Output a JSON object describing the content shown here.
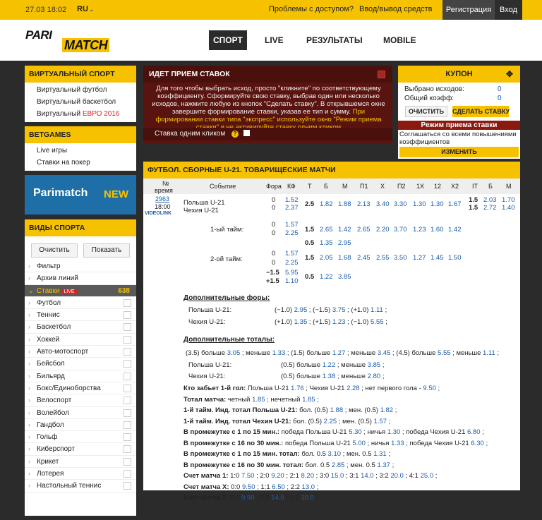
{
  "topbar": {
    "date": "27.03 18:02",
    "lang": "RU",
    "problems": "Проблемы с доступом?",
    "deposit": "Ввод/вывод средств",
    "register": "Регистрация",
    "login": "Вход"
  },
  "logo": {
    "top": "PARI",
    "bottom": "MATCH"
  },
  "nav": {
    "sport": "СПОРТ",
    "live": "LIVE",
    "results": "РЕЗУЛЬТАТЫ",
    "mobile": "MOBILE"
  },
  "virtual": {
    "title": "ВИРТУАЛЬНЫЙ СПОРТ",
    "items": [
      "Виртуальный футбол",
      "Виртуальный баскетбол",
      "Виртуальный "
    ],
    "euro": "ЕВРО 2016"
  },
  "betgames": {
    "title": "BETGAMES",
    "items": [
      "Live игры",
      "Ставки на покер"
    ]
  },
  "banner": {
    "name": "Parimatch",
    "new": "NEW"
  },
  "sports": {
    "title": "ВИДЫ СПОРТА",
    "clear": "Очистить",
    "show": "Показать",
    "filter": "Фильтр",
    "archive": "Архив линий",
    "stakes": "Ставки",
    "live": "LIVE",
    "count": "638",
    "items": [
      "Футбол",
      "Теннис",
      "Баскетбол",
      "Хоккей",
      "Авто-мотоспорт",
      "Бейсбол",
      "Бильярд",
      "Бокс/Единоборства",
      "Велоспорт",
      "Волейбол",
      "Гандбол",
      "Гольф",
      "Киберспорт",
      "Крикет",
      "Лотерея",
      "Настольный теннис"
    ]
  },
  "accept": {
    "title": "ИДЕТ ПРИЕМ СТАВОК",
    "text": "Для того чтобы выбрать исход, просто \"кликните\" по соответствующему коэффициенту. Сформируйте свою ставку, выбрав один или несколько исходов, нажмите любую из кнопок \"Сделать ставку\". В открывшемся окне завершите формирование ставки, указав ее тип и сумму.",
    "hl": "При формировании ставки типа \"экспресс\" используйте окно \"Режим приема ставки\" и не активируйте ставку одним кликом",
    "oneclick": "Ставка одним кликом"
  },
  "coupon": {
    "title": "КУПОН",
    "selected_label": "Выбрано исходов:",
    "selected": "0",
    "total_label": "Общий коэфф:",
    "total": "0",
    "clear": "ОЧИСТИТЬ",
    "bet": "СДЕЛАТЬ СТАВКУ",
    "mode": "Режим приема ставки",
    "agree": "Соглашаться со всеми повышениями коэффициентов",
    "change": "ИЗМЕНИТЬ"
  },
  "main": {
    "title": "ФУТБОЛ. СБОРНЫЕ U-21. ТОВАРИЩЕСКИЕ МАТЧИ",
    "cols": {
      "num": "№",
      "time": "время",
      "event": "Событие",
      "fora": "Фора",
      "kf": "КФ",
      "t": "Т",
      "b": "Б",
      "m": "М",
      "p1": "П1",
      "x": "Х",
      "p2": "П2",
      "x1": "1Х",
      "x12": "12",
      "x2": "Х2",
      "it": "ІТ",
      "b2": "Б",
      "m2": "М"
    },
    "match": {
      "num": "2963",
      "time": "18:00",
      "video": "VIDEOLINK",
      "team1": "Польша U-21",
      "team2": "Чехия U-21"
    },
    "r1": {
      "f1": "0",
      "f2": "0",
      "k1": "1.52",
      "k2": "2.37",
      "t": "2.5",
      "b": "1.82",
      "m": "1.88",
      "p1": "2.13",
      "x": "3.40",
      "p2": "3.30",
      "x1": "1.30",
      "x12": "1.30",
      "x2": "1.67",
      "it1": "1.5",
      "it2": "1.5",
      "ib1": "2.03",
      "ib2": "2.72",
      "im1": "1.70",
      "im2": "1.40"
    },
    "r2": {
      "label": "1-ый тайм:",
      "f1": "0",
      "f2": "0",
      "k1": "1.57",
      "k2": "2.25",
      "t": "1.5",
      "b": "2.65",
      "m": "1.42",
      "p1": "2.65",
      "x": "2.20",
      "p2": "3.70",
      "x1": "1.23",
      "x12": "1.60",
      "x2": "1.42",
      "t2": "0.5",
      "b2": "1.35",
      "m2": "2.95"
    },
    "r3": {
      "label": "2-ой тайм:",
      "f1": "0",
      "f2": "0",
      "k1": "1.57",
      "k2": "2.25",
      "t": "1.5",
      "b": "2.05",
      "m": "1.68",
      "p1": "2.45",
      "x": "2.55",
      "p2": "3.50",
      "x1": "1.27",
      "x12": "1.45",
      "x2": "1.50",
      "f3": "−1.5",
      "f4": "+1.5",
      "k3": "5.95",
      "k4": "1.10",
      "t2": "0.5",
      "b2": "1.22",
      "m2": "3.85"
    },
    "addfora": {
      "title": "Дополнительные форы:",
      "t1": "Польша U-21:",
      "t2": "Чехия U-21:",
      "l1": [
        "(−1.0)",
        "2.95",
        "(−1.5)",
        "3.75",
        "(+1.0)",
        "1.11"
      ],
      "l2": [
        "(+1.0)",
        "1.35",
        "(+1.5)",
        "1.23",
        "(−1.0)",
        "5.55"
      ]
    },
    "addtot": {
      "title": "Дополнительные тоталы:",
      "l1": "(3.5) больше",
      "v1": "3.05",
      "l1b": "меньше",
      "v1b": "1.33",
      "l1c": "(1.5) больше",
      "v1c": "1.27",
      "l1d": "меньше",
      "v1d": "3.45",
      "l1e": "(4.5) больше",
      "v1e": "5.55",
      "l1f": "меньше",
      "v1f": "1.11",
      "t1": "Польша U-21:",
      "l2": "(0.5) больше",
      "v2": "1.22",
      "l2b": "меньше",
      "v2b": "3.85",
      "t2": "Чехия U-21:",
      "l3": "(0.5) больше",
      "v3": "1.38",
      "l3b": "меньше",
      "v3b": "2.80"
    },
    "lines": [
      {
        "b": "Кто забьет 1-й гол:",
        "rest": [
          [
            "Польша U-21",
            "1.76"
          ],
          [
            "Чехия U-21",
            "2.28"
          ],
          [
            "нет первого гола -",
            "9.50"
          ]
        ]
      },
      {
        "b": "Тотал матча:",
        "rest": [
          [
            "четный",
            "1.85"
          ],
          [
            "нечетный",
            "1.85"
          ]
        ]
      },
      {
        "b": "1-й тайм. Инд. тотал Польша U-21:",
        "rest": [
          [
            "бол. (0.5)",
            "1.88"
          ],
          [
            "мен. (0.5)",
            "1.82"
          ]
        ]
      },
      {
        "b": "1-й тайм. Инд. тотал Чехия U-21:",
        "rest": [
          [
            "бол. (0.5)",
            "2.25"
          ],
          [
            "мен. (0.5)",
            "1.57"
          ]
        ]
      },
      {
        "b": "В промежутке с 1 по 15 мин.:",
        "rest": [
          [
            "победа Польша U-21",
            "5.30"
          ],
          [
            "ничья",
            "1.30"
          ],
          [
            "победа Чехия U-21",
            "6.80"
          ]
        ]
      },
      {
        "b": "В промежутке с 16 по 30 мин.:",
        "rest": [
          [
            "победа Польша U-21",
            "5.00"
          ],
          [
            "ничья",
            "1.33"
          ],
          [
            "победа Чехия U-21",
            "6.30"
          ]
        ]
      },
      {
        "b": "В промежутке с 1 по 15 мин. тотал:",
        "rest": [
          [
            "бол. 0.5",
            "3.10"
          ],
          [
            "мен. 0.5",
            "1.31"
          ]
        ]
      },
      {
        "b": "В промежутке с 16 по 30 мин. тотал:",
        "rest": [
          [
            "бол. 0.5",
            "2.85"
          ],
          [
            "мен. 0.5",
            "1.37"
          ]
        ]
      },
      {
        "b": "Счет матча 1:",
        "rest": [
          [
            "1:0",
            "7.50"
          ],
          [
            "2:0",
            "9.20"
          ],
          [
            "2:1",
            "8.20"
          ],
          [
            "3:0",
            "15.0"
          ],
          [
            "3:1",
            "14.0"
          ],
          [
            "3:2",
            "20.0"
          ],
          [
            "4:1",
            "25.0"
          ]
        ]
      },
      {
        "b": "Счет матча Х:",
        "rest": [
          [
            "0:0",
            "9.50"
          ],
          [
            "1:1",
            "6.50"
          ],
          [
            "2:2",
            "13.0"
          ]
        ]
      },
      {
        "b": "Счет матча 2:",
        "rest": [
          [
            "0:1",
            "9.90"
          ],
          [
            "0:2",
            "14.0"
          ],
          [
            "1:2",
            "10.0"
          ]
        ]
      }
    ]
  },
  "colors": {
    "yellow": "#f6c200",
    "dark": "#2b2b2b",
    "link": "#1a5da8",
    "red": "#e02020"
  }
}
